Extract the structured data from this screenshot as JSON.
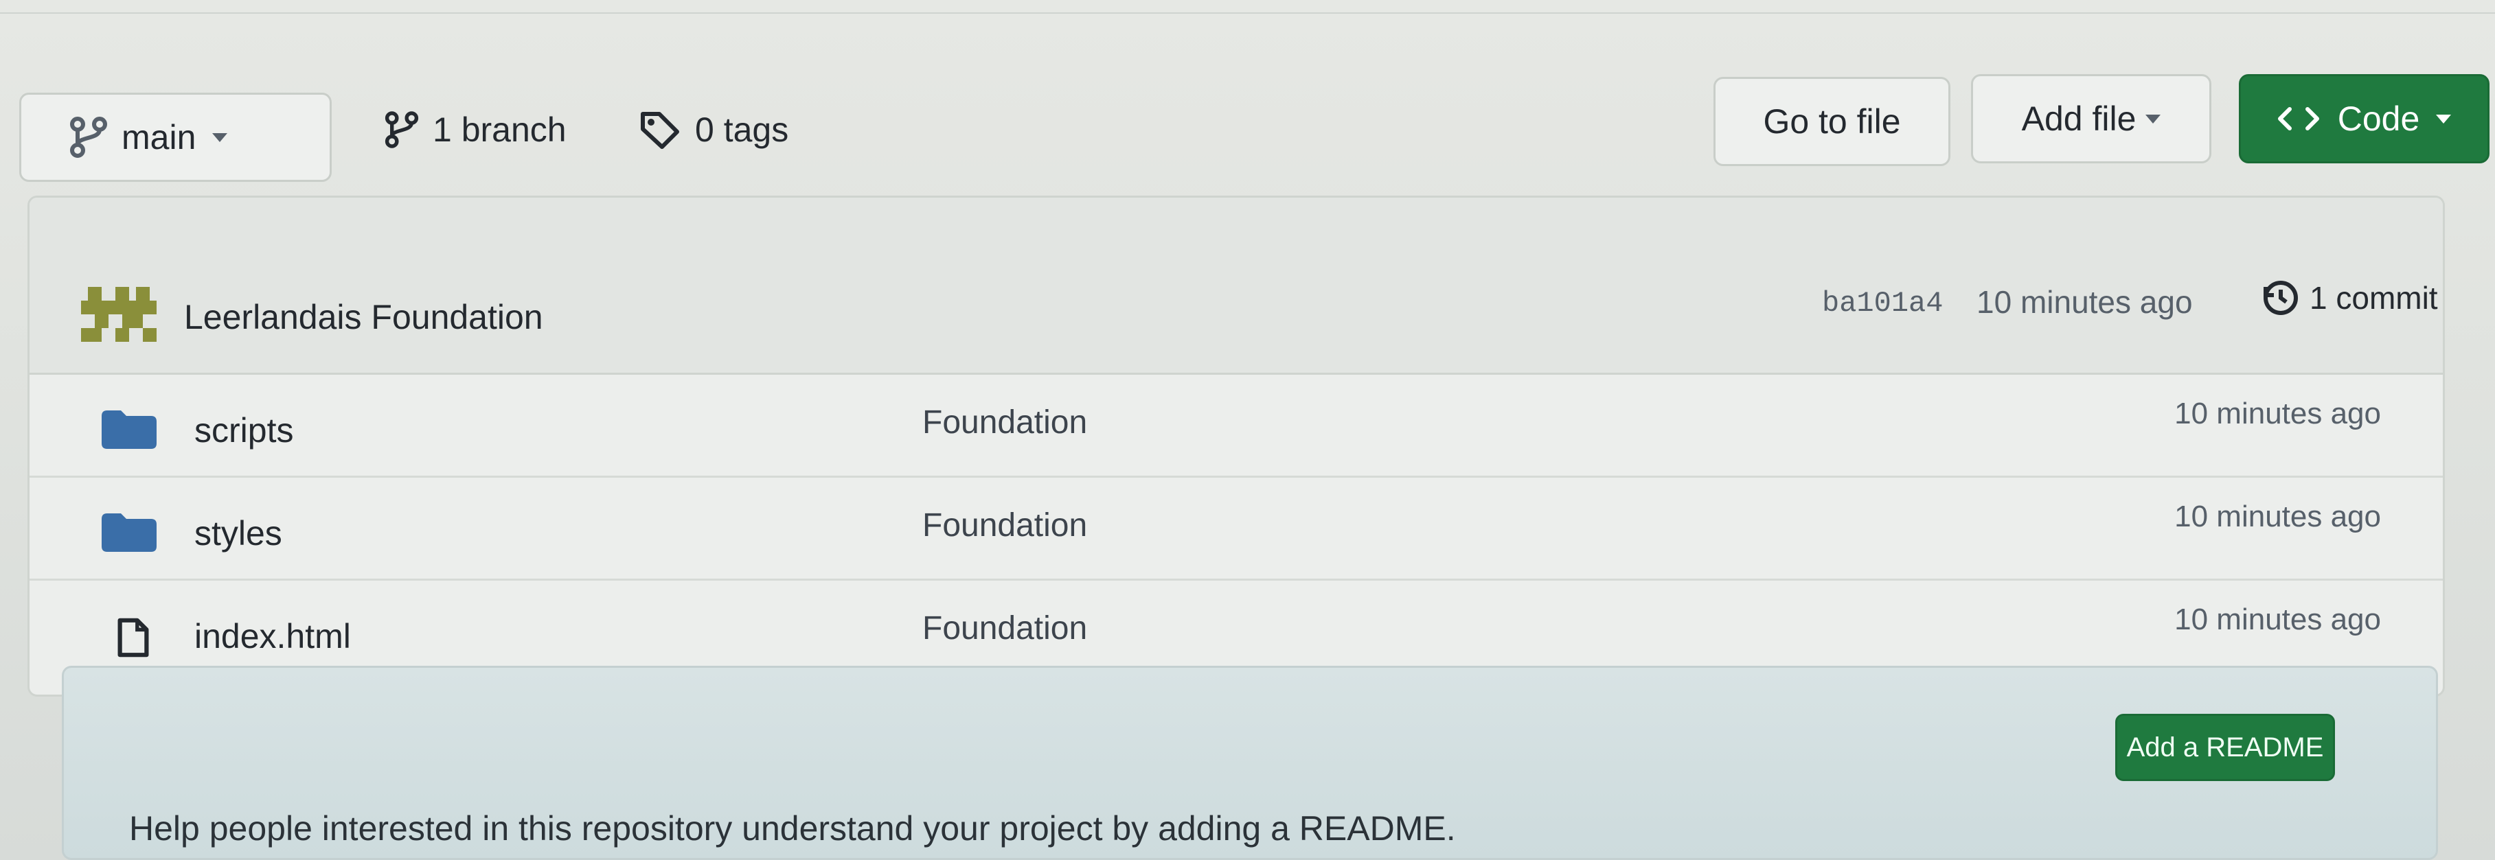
{
  "toolbar": {
    "branch_selector": "main",
    "branches": "1 branch",
    "tags": "0 tags",
    "go_to_file": "Go to file",
    "add_file": "Add file",
    "code": "Code"
  },
  "latest_commit": {
    "author": "Leerlandais Foundation",
    "sha": "ba101a4",
    "time": "10 minutes ago",
    "commits": "1 commit"
  },
  "files": [
    {
      "name": "scripts",
      "type": "folder",
      "message": "Foundation",
      "time": "10 minutes ago"
    },
    {
      "name": "styles",
      "type": "folder",
      "message": "Foundation",
      "time": "10 minutes ago"
    },
    {
      "name": "index.html",
      "type": "file",
      "message": "Foundation",
      "time": "10 minutes ago"
    }
  ],
  "readme": {
    "prompt": "Help people interested in this repository understand your project by adding a README.",
    "button": "Add a README"
  },
  "colors": {
    "primary_green": "#1f7a3f",
    "folder_blue": "#3a6ea8"
  }
}
